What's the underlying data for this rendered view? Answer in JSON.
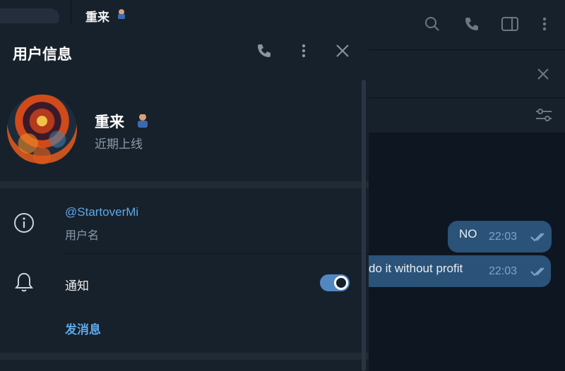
{
  "chat": {
    "name": "重来",
    "messages": [
      {
        "text": "NO",
        "time": "22:03"
      },
      {
        "text": "do it without profit",
        "time": "22:03"
      }
    ]
  },
  "panel": {
    "title": "用户信息",
    "profile": {
      "name": "重来",
      "status": "近期上线"
    },
    "username": {
      "value": "@StartoverMi",
      "label": "用户名"
    },
    "notifications": {
      "label": "通知",
      "enabled": true
    },
    "send_message_label": "发消息"
  },
  "colors": {
    "background": "#0e1621",
    "panel": "#17212b",
    "accent": "#5288c1",
    "link": "#5fa8e8",
    "bubble": "#2b5278",
    "secondary_text": "#8b9cad"
  },
  "icons": {
    "topbar": [
      "search-icon",
      "phone-icon",
      "sidebar-toggle-icon",
      "more-vertical-icon"
    ],
    "pinned": [
      "close-icon"
    ],
    "filter": [
      "filter-sliders-icon"
    ],
    "panel_header": [
      "phone-icon",
      "more-vertical-icon",
      "close-icon"
    ],
    "rows": [
      "info-icon",
      "bell-icon"
    ]
  }
}
